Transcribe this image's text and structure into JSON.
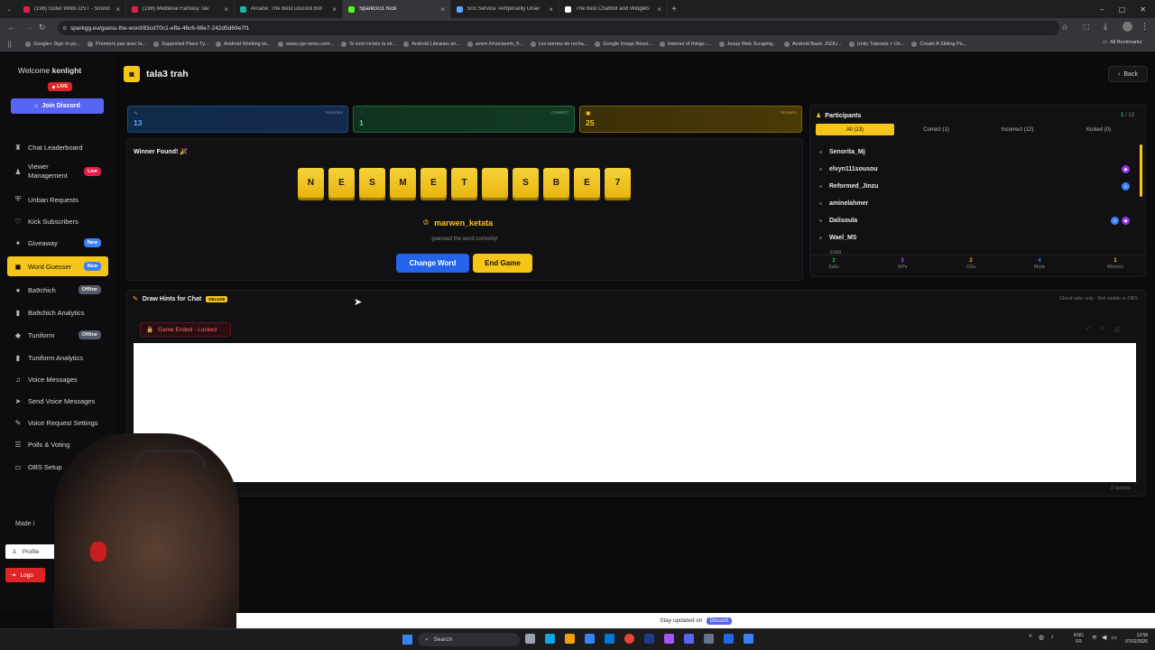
{
  "browser": {
    "tabs": [
      {
        "title": "(198) Outer Wilds OST - Sound",
        "color": "#e11d48"
      },
      {
        "title": "(198) Medieval Fantasy Tav",
        "color": "#e11d48"
      },
      {
        "title": "Arcane: The Best Discord Bot",
        "color": "#14b8a6"
      },
      {
        "title": "SparkGG1 Kick",
        "color": "#53fc18",
        "active": true
      },
      {
        "title": "503 Service Temporarily Unav",
        "color": "#60a5fa"
      },
      {
        "title": "The best ChatBot and Widgets",
        "color": "#ffffff"
      }
    ],
    "url": "sparkgg.eu/guess-the-word/83cd70c1-effa-46c6-98e7-242d5d69e7f1",
    "bookmarks": [
      "Google+ Sign-In po...",
      "Premiers pas avec la...",
      "Supported Place Ty...",
      "Android Working wi...",
      "www.cge-news.com...",
      "Si sont nichés la str...",
      "Android Libraries an...",
      "avem.fr/rss/avem_fl...",
      "Les bornes de recha...",
      "Google Image Resul...",
      "internet of things -...",
      "Jsoup Web Scraping...",
      "Android Basic JSOU...",
      "Unity Tutorials > Un...",
      "Create A Sliding Pa..."
    ],
    "all_bookmarks": "All Bookmarks"
  },
  "sidebar": {
    "welcome": "Welcome",
    "username": "kenlight",
    "live": "LIVE",
    "join_discord": "Join Discord",
    "items": [
      {
        "label": "Chat Leaderboard",
        "icon": "trophy-icon",
        "glyph": "♜"
      },
      {
        "label": "Viewer Management",
        "icon": "users-icon",
        "glyph": "♟",
        "badge": "Live",
        "badge_type": "live"
      },
      {
        "label": "Unban Requests",
        "icon": "shield-icon",
        "glyph": "⛨"
      },
      {
        "label": "Kick Subscribers",
        "icon": "heart-icon",
        "glyph": "♡"
      },
      {
        "label": "Giveaway",
        "icon": "gift-icon",
        "glyph": "✦",
        "badge": "New",
        "badge_type": "new"
      },
      {
        "label": "Word Guesser",
        "icon": "gamepad-icon",
        "glyph": "◼",
        "badge": "New",
        "badge_type": "new",
        "active": true
      },
      {
        "label": "Ba9chich",
        "icon": "ba9chich-icon",
        "glyph": "●",
        "badge": "Offline",
        "badge_type": "off"
      },
      {
        "label": "Ba9chich Analytics",
        "icon": "chart-icon",
        "glyph": "▮"
      },
      {
        "label": "Tuniform",
        "icon": "tuniform-icon",
        "glyph": "◆",
        "badge": "Offline",
        "badge_type": "off"
      },
      {
        "label": "Tuniform Analytics",
        "icon": "chart-icon",
        "glyph": "▮"
      },
      {
        "label": "Voice Messages",
        "icon": "mic-icon",
        "glyph": "♫"
      },
      {
        "label": "Send Voice Messages",
        "icon": "send-icon",
        "glyph": "➤"
      },
      {
        "label": "Voice Request Settings",
        "icon": "settings-icon",
        "glyph": "✎"
      },
      {
        "label": "Polls & Voting",
        "icon": "poll-icon",
        "glyph": "☰"
      },
      {
        "label": "OBS Setup",
        "icon": "monitor-icon",
        "glyph": "▭"
      }
    ],
    "made_by": "Made i",
    "profile": "Profile",
    "logout": "Logo"
  },
  "header": {
    "title": "tala3 trah",
    "back": "Back"
  },
  "stats": [
    {
      "label": "GUESSES",
      "value": "13",
      "color": "#3b82f6"
    },
    {
      "label": "CORRECT",
      "value": "1",
      "color": "#22c55e"
    },
    {
      "label": "REWARD",
      "value": "25",
      "color": "#eab308"
    }
  ],
  "game": {
    "winner_label": "Winner Found! 🎉",
    "tiles": [
      "N",
      "E",
      "S",
      "M",
      "E",
      "T",
      "",
      "S",
      "B",
      "E",
      "7"
    ],
    "winner_name": "marwen_ketata",
    "winner_sub": "guessed the word correctly!",
    "change_word": "Change Word",
    "end_game": "End Game"
  },
  "participants": {
    "title": "Participants",
    "count": "1",
    "total": "13",
    "tabs": [
      "All (13)",
      "Correct (1)",
      "Incorrect (12)",
      "Kicked (0)"
    ],
    "list": [
      {
        "name": "Senorita_Mj"
      },
      {
        "name": "elvyn111sousou",
        "role": "purple"
      },
      {
        "name": "Reformed_Jinzu",
        "role": "blue"
      },
      {
        "name": "aminelahmer"
      },
      {
        "name": "Dalisoula",
        "role": "both"
      },
      {
        "name": "Wael_MS"
      }
    ],
    "summary": [
      {
        "n": "2",
        "l": "Subs",
        "color": "#22c55e"
      },
      {
        "n": "3",
        "l": "VIPs",
        "color": "#a855f7"
      },
      {
        "n": "2",
        "l": "OGs",
        "color": "#eab308"
      },
      {
        "n": "4",
        "l": "Mods",
        "color": "#3b82f6"
      },
      {
        "n": "1",
        "l": "Winners",
        "color": "#f5c518"
      }
    ]
  },
  "hints": {
    "title": "Draw Hints for Chat",
    "deluxe": "DELUXE",
    "note": "Client-side only · Not visible in OBS",
    "locked": "Game Ended - Locked",
    "actions": "0 actions"
  },
  "footer": {
    "stay": "Stay updated on",
    "discord": "Discord"
  },
  "taskbar": {
    "search": "Search",
    "lang1": "ENG",
    "lang2": "FR",
    "time": "12:58",
    "date": "07/02/2026"
  }
}
